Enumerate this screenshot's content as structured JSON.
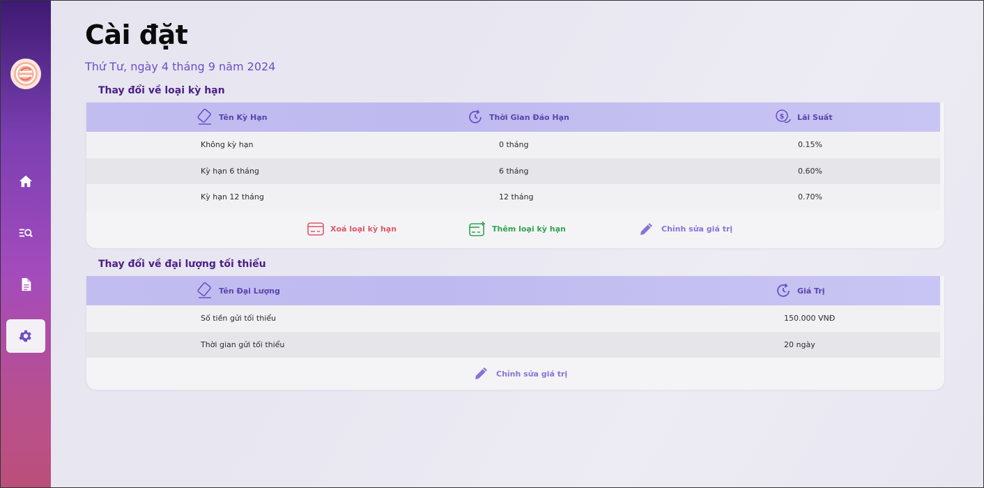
{
  "app": {
    "logo_icon": "circular-logo-icon",
    "colors": {
      "accent": "#6b4fc9",
      "header_bg": "#c2bdf0",
      "delete": "#e0556a",
      "add": "#2ea44f",
      "edit": "#8a72d6"
    }
  },
  "sidebar": {
    "items": [
      {
        "icon": "home-icon",
        "active": false
      },
      {
        "icon": "search-list-icon",
        "active": false
      },
      {
        "icon": "document-icon",
        "active": false
      },
      {
        "icon": "gear-icon",
        "active": true
      }
    ]
  },
  "header": {
    "title": "Cài đặt",
    "date": "Thứ Tư, ngày 4 tháng 9 năm 2024"
  },
  "terms": {
    "section_title": "Thay đổi về loại kỳ hạn",
    "columns": [
      "Tên Kỳ Hạn",
      "Thời Gian Đáo Hạn",
      "Lãi Suất"
    ],
    "rows": [
      [
        "Không kỳ hạn",
        "0 tháng",
        "0.15%"
      ],
      [
        "Kỳ hạn 6 tháng",
        "6 tháng",
        "0.60%"
      ],
      [
        "Kỳ hạn 12 tháng",
        "12 tháng",
        "0.70%"
      ]
    ],
    "actions": {
      "delete_label": "Xoá loại kỳ hạn",
      "add_label": "Thêm loại kỳ hạn",
      "edit_label": "Chỉnh sửa giá trị"
    }
  },
  "minimums": {
    "section_title": "Thay đổi về đại lượng tối thiểu",
    "columns": [
      "Tên Đại Lượng",
      "Giá Trị"
    ],
    "rows": [
      [
        "Số tiền gửi tối thiểu",
        "150.000 VNĐ"
      ],
      [
        "Thời gian gửi tối thiểu",
        "20 ngày"
      ]
    ],
    "actions": {
      "edit_label": "Chỉnh sửa giá trị"
    }
  }
}
